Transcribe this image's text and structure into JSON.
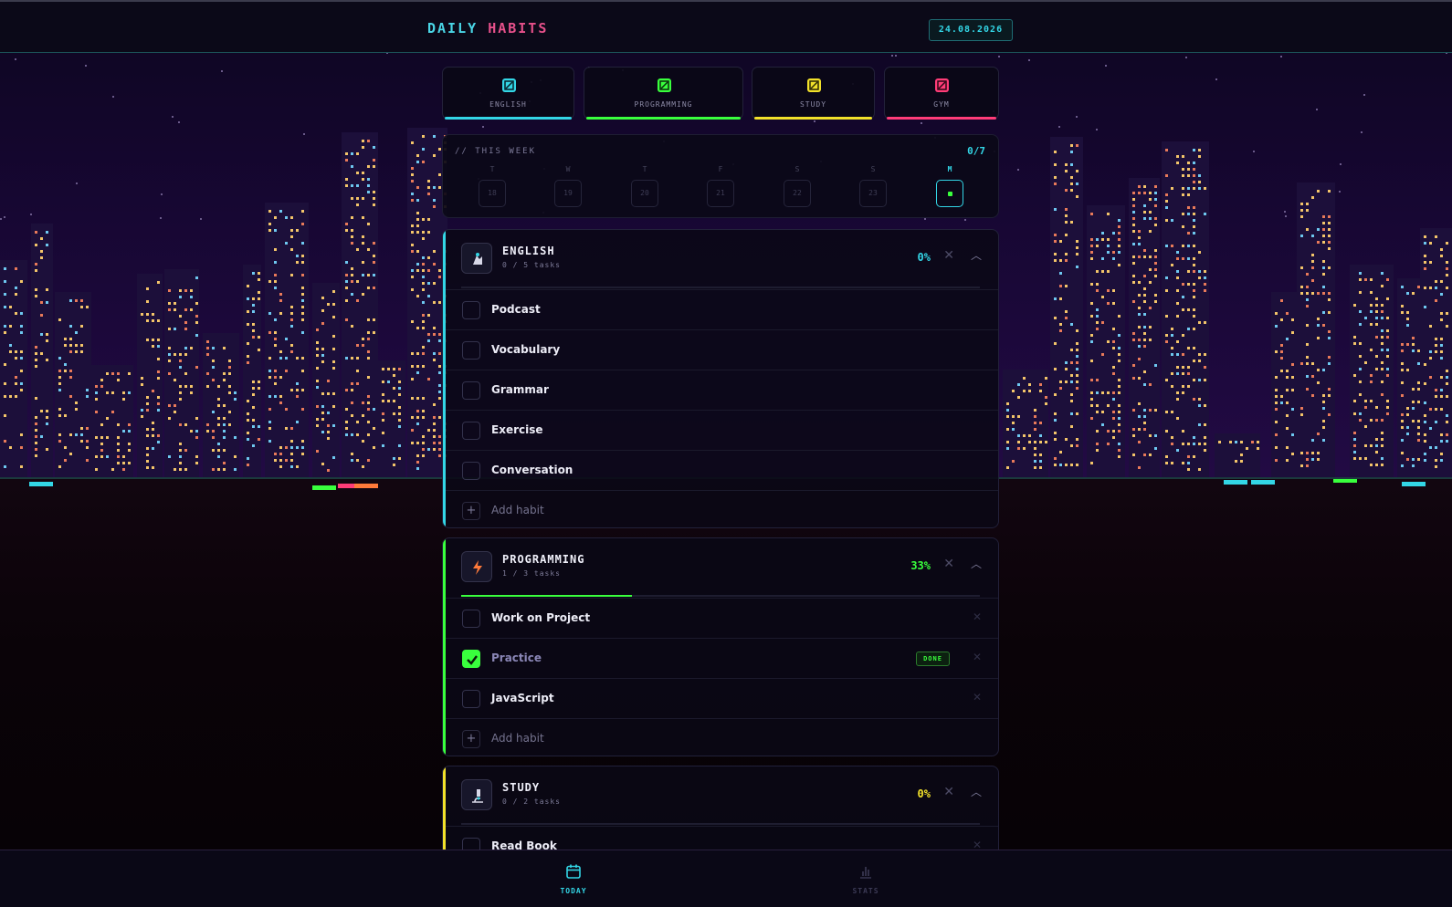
{
  "header": {
    "title_part1": "DAILY",
    "title_part2": "HABITS",
    "date": "24.08.2026"
  },
  "colors": {
    "english": "#33d6e6",
    "programming": "#39ff3d",
    "study": "#f2e12a",
    "gym": "#ff3c78"
  },
  "categories": [
    {
      "label": "ENGLISH",
      "color": "#33d6e6"
    },
    {
      "label": "PROGRAMMING",
      "color": "#39ff3d"
    },
    {
      "label": "STUDY",
      "color": "#f2e12a"
    },
    {
      "label": "GYM",
      "color": "#ff3c78"
    }
  ],
  "week": {
    "title": "// THIS WEEK",
    "count": "0/7",
    "days": [
      {
        "letter": "T",
        "date": "18"
      },
      {
        "letter": "W",
        "date": "19"
      },
      {
        "letter": "T",
        "date": "20"
      },
      {
        "letter": "F",
        "date": "21"
      },
      {
        "letter": "S",
        "date": "22"
      },
      {
        "letter": "S",
        "date": "23"
      },
      {
        "letter": "M",
        "date": ""
      }
    ]
  },
  "habits": {
    "english": {
      "name": "ENGLISH",
      "tasks": "0 / 5 tasks",
      "percent": "0%",
      "progress": 0,
      "icon": "typing-icon",
      "items": [
        {
          "label": "Podcast",
          "done": false
        },
        {
          "label": "Vocabulary",
          "done": false
        },
        {
          "label": "Grammar",
          "done": false
        },
        {
          "label": "Exercise",
          "done": false
        },
        {
          "label": "Conversation",
          "done": false
        }
      ],
      "add_label": "Add habit"
    },
    "programming": {
      "name": "PROGRAMMING",
      "tasks": "1 / 3 tasks",
      "percent": "33%",
      "progress": 0.33,
      "icon": "lightning-icon",
      "items": [
        {
          "label": "Work on Project",
          "done": false
        },
        {
          "label": "Practice",
          "done": true,
          "badge": "DONE"
        },
        {
          "label": "JavaScript",
          "done": false
        }
      ],
      "add_label": "Add habit"
    },
    "study": {
      "name": "STUDY",
      "tasks": "0 / 2 tasks",
      "percent": "0%",
      "progress": 0,
      "icon": "microscope-icon",
      "items": [
        {
          "label": "Read Book",
          "done": false
        }
      ]
    }
  },
  "nav": {
    "today": "TODAY",
    "stats": "STATS"
  }
}
